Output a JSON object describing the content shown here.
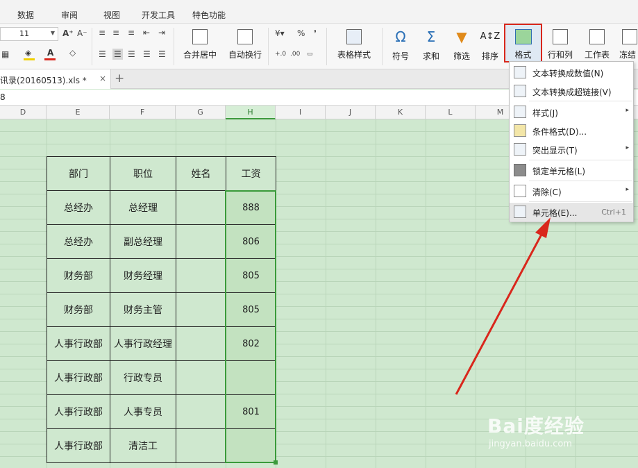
{
  "menu": {
    "items": [
      "数据",
      "审阅",
      "视图",
      "开发工具",
      "特色功能"
    ]
  },
  "ribbon": {
    "font_size": "11",
    "buttons": {
      "merge_center": "合并居中",
      "wrap_text": "自动换行",
      "table_style": "表格样式",
      "symbol": "符号",
      "sum": "求和",
      "filter": "筛选",
      "sort": "排序",
      "format": "格式",
      "row_col": "行和列",
      "worksheet": "工作表",
      "freeze": "冻结"
    },
    "percent_symbol": "%",
    "comma_symbol": "❜"
  },
  "tab": {
    "doc_title": "讯录(20160513).xls *",
    "close": "×",
    "add": "+"
  },
  "formula_bar": {
    "cell_ref": "8"
  },
  "columns": [
    "D",
    "E",
    "F",
    "G",
    "H",
    "I",
    "J",
    "K",
    "L",
    "M"
  ],
  "table": {
    "headers": [
      "部门",
      "职位",
      "姓名",
      "工资"
    ],
    "rows": [
      [
        "总经办",
        "总经理",
        "",
        "888"
      ],
      [
        "总经办",
        "副总经理",
        "",
        "806"
      ],
      [
        "财务部",
        "财务经理",
        "",
        "805"
      ],
      [
        "财务部",
        "财务主管",
        "",
        "805"
      ],
      [
        "人事行政部",
        "人事行政经理",
        "",
        "802"
      ],
      [
        "人事行政部",
        "行政专员",
        "",
        ""
      ],
      [
        "人事行政部",
        "人事专员",
        "",
        "801"
      ],
      [
        "人事行政部",
        "清洁工",
        "",
        ""
      ]
    ]
  },
  "dropdown": {
    "items": [
      {
        "label": "文本转换成数值(N)",
        "icon": "text-to-number-icon"
      },
      {
        "label": "文本转换成超链接(V)",
        "icon": "text-to-link-icon"
      },
      {
        "label": "样式(J)",
        "icon": "style-icon",
        "arrow": "▸"
      },
      {
        "label": "条件格式(D)...",
        "icon": "conditional-format-icon"
      },
      {
        "label": "突出显示(T)",
        "icon": "highlight-icon",
        "arrow": "▸"
      },
      {
        "label": "锁定单元格(L)",
        "icon": "lock-icon"
      },
      {
        "label": "清除(C)",
        "icon": "eraser-icon",
        "arrow": "▸"
      },
      {
        "label": "单元格(E)...",
        "icon": "cell-format-icon",
        "shortcut": "Ctrl+1"
      }
    ]
  },
  "watermark": {
    "brand": "Bai度经验",
    "url": "jingyan.baidu.com"
  },
  "colors": {
    "sheet_bg": "#cfe8cf",
    "selection": "#3a9a3a",
    "highlight_box": "#d9271c",
    "arrow": "#d9271c"
  }
}
